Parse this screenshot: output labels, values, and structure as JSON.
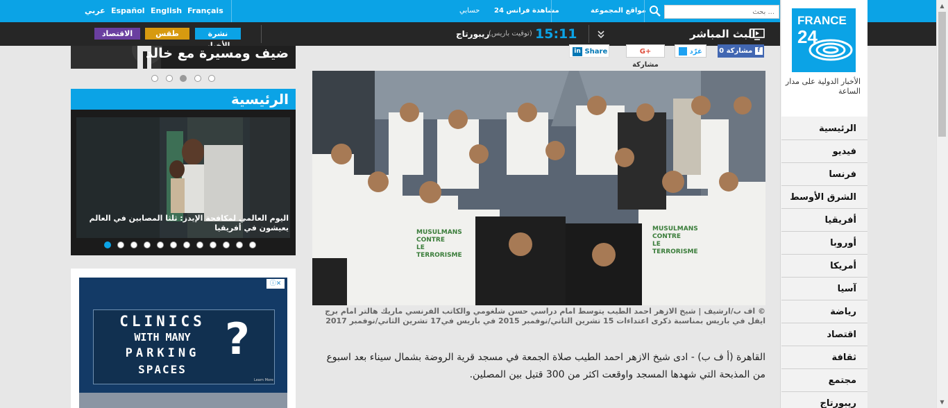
{
  "top_bar": {
    "languages": [
      "عربي",
      "Español",
      "English",
      "Français"
    ],
    "links": [
      "مشاهدة فرانس 24",
      "حسابي",
      "مواقع المجموعة"
    ],
    "search_placeholder": "بحث ..."
  },
  "second_bar": {
    "live_label": "البث المباشر",
    "time": "15:11",
    "time_note": "(توقيت باريس)",
    "reportage": "ريبورتاج",
    "tags": [
      {
        "label": "نشرة الأخبار",
        "color": "#0ba3e6"
      },
      {
        "label": "طقس",
        "color": "#d79a10"
      },
      {
        "label": "الاقتصاد",
        "color": "#6a3fa0"
      }
    ]
  },
  "brand": {
    "logo_line1": "FRANCE",
    "logo_line2": "24",
    "tagline": "الأخبار الدولية على مدار الساعة"
  },
  "nav": {
    "items": [
      "الرئيسية",
      "فيديو",
      "فرنسا",
      "الشرق الأوسط",
      "أفريقيا",
      "أوروبا",
      "أمريكا",
      "آسيا",
      "رياضة",
      "اقتصاد",
      "ثقافة",
      "مجتمع",
      "ريبورتاج"
    ]
  },
  "share": {
    "facebook": "مشاركة 0",
    "twitter": "غرّد",
    "google": "مشاركة",
    "linkedin": "Share"
  },
  "article": {
    "caption": "© اف ب/ارشيف | شيخ الازهر احمد الطيب يتوسط امام دراسي حسن شلغومي والكاتب الفرنسي ماريك هالتر امام برج ايفل في باريس بمناسبة ذكرى اعتداءات 15 تشرين الثاني/نوفمبر 2015 في باريس في17 تشرين الثاني/نوفمبر 2017",
    "body": "القاهرة (أ ف ب) - ادى شيخ الازهر احمد الطيب صلاة الجمعة في مسجد قرية الروضة بشمال سيناء بعد اسبوع من المذبحة التي شهدها المسجد واوقعت اكثر من 300 قتيل بين المصلين.",
    "shirt_text": "MUSULMANS CONTRE LE TERRORISME"
  },
  "left": {
    "banner_title": "ضيف ومسيرة مع خالد",
    "home_title": "الرئيسية",
    "home_caption": "اليوم العالمي لمكافحة الإيدز: ثلثا المصابين في العالم يعيشون في أفريقيا",
    "ad_lines": [
      "CLINICS",
      "WITH MANY",
      "PARKING",
      "SPACES"
    ],
    "ad_mark": "?",
    "ad_footer": "Learn More"
  }
}
